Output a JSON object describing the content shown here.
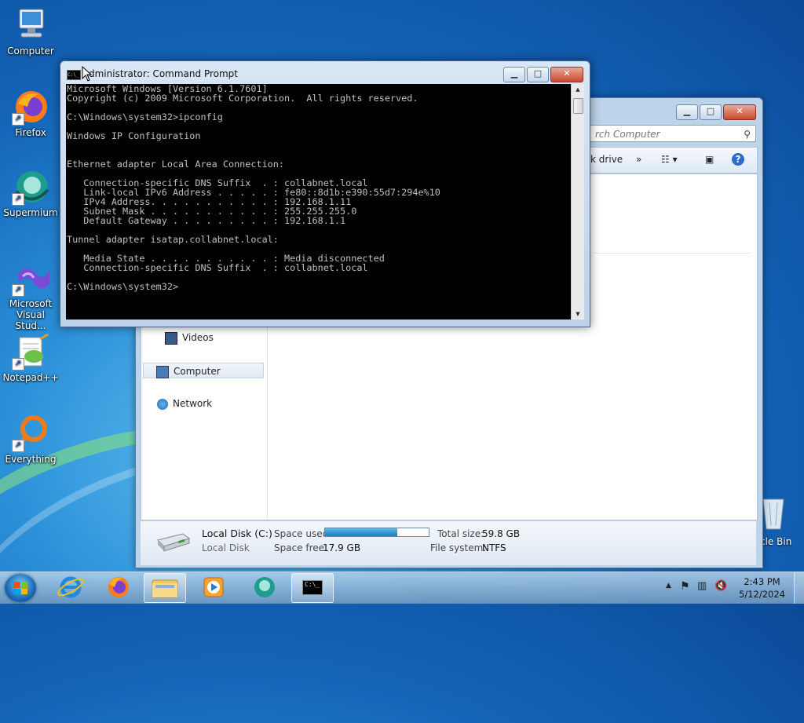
{
  "desktop": {
    "icons": [
      {
        "label": "Computer"
      },
      {
        "label": "Firefox"
      },
      {
        "label": "Supermium"
      },
      {
        "label": "Microsoft Visual Stud..."
      },
      {
        "label": "Notepad++"
      },
      {
        "label": "Everything"
      }
    ],
    "recycle_bin_label": "cle Bin"
  },
  "explorer": {
    "search_placeholder": "rch Computer",
    "cmdbar": {
      "map_drive": "k drive",
      "more": "»"
    },
    "nav": [
      {
        "label": "Videos"
      },
      {
        "label": "Computer"
      },
      {
        "label": "Network"
      }
    ],
    "details": {
      "drive_name": "Local Disk (C:)",
      "drive_type": "Local Disk",
      "space_used_label": "Space used:",
      "space_used_fraction": 0.7,
      "space_free_label": "Space free:",
      "space_free_value": "17.9 GB",
      "total_size_label": "Total size:",
      "total_size_value": "59.8 GB",
      "file_system_label": "File system:",
      "file_system_value": "NTFS"
    }
  },
  "cmd": {
    "icon_text": "C:\\_",
    "title": "Administrator: Command Prompt",
    "lines": [
      "Microsoft Windows [Version 6.1.7601]",
      "Copyright (c) 2009 Microsoft Corporation.  All rights reserved.",
      "",
      "C:\\Windows\\system32>ipconfig",
      "",
      "Windows IP Configuration",
      "",
      "",
      "Ethernet adapter Local Area Connection:",
      "",
      "   Connection-specific DNS Suffix  . : collabnet.local",
      "   Link-local IPv6 Address . . . . . : fe80::8d1b:e390:55d7:294e%10",
      "   IPv4 Address. . . . . . . . . . . : 192.168.1.11",
      "   Subnet Mask . . . . . . . . . . . : 255.255.255.0",
      "   Default Gateway . . . . . . . . . : 192.168.1.1",
      "",
      "Tunnel adapter isatap.collabnet.local:",
      "",
      "   Media State . . . . . . . . . . . : Media disconnected",
      "   Connection-specific DNS Suffix  . : collabnet.local",
      "",
      "C:\\Windows\\system32>"
    ]
  },
  "window_controls": {
    "minimize": "▁",
    "maximize": "□",
    "close": "✕"
  },
  "taskbar": {
    "apps": [
      "internet-explorer",
      "firefox",
      "windows-explorer",
      "media-player",
      "supermium",
      "command-prompt"
    ],
    "cmd_icon_text": "C:\\_",
    "clock_time": "2:43 PM",
    "clock_date": "5/12/2024"
  }
}
